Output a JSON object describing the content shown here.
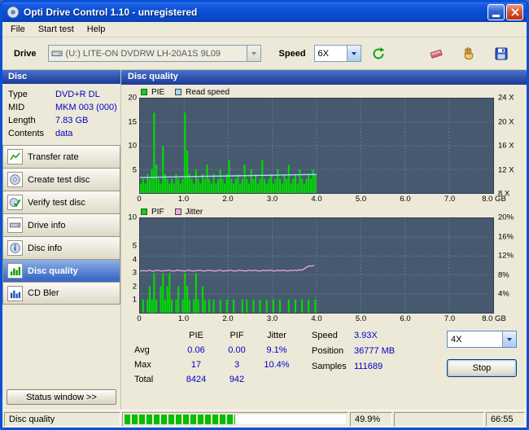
{
  "window": {
    "title": "Opti Drive Control 1.10 - unregistered"
  },
  "menu": {
    "items": [
      "File",
      "Start test",
      "Help"
    ]
  },
  "toolbar": {
    "drive_label": "Drive",
    "drive_value": "(U:) LITE-ON DVDRW LH-20A1S 9L09",
    "speed_label": "Speed",
    "speed_value": "6X"
  },
  "sidebar": {
    "header": "Disc",
    "info": [
      {
        "label": "Type",
        "value": "DVD+R DL"
      },
      {
        "label": "MID",
        "value": "MKM 003 (000)"
      },
      {
        "label": "Length",
        "value": "7.83 GB"
      },
      {
        "label": "Contents",
        "value": "data"
      }
    ],
    "buttons": [
      "Transfer rate",
      "Create test disc",
      "Verify test disc",
      "Drive info",
      "Disc info",
      "Disc quality",
      "CD Bler"
    ],
    "active": "Disc quality",
    "status_window_label": "Status window >>"
  },
  "main": {
    "header": "Disc quality"
  },
  "chart_data": [
    {
      "type": "bar",
      "title": "PIE and read speed vs disc position",
      "legend": [
        "PIE",
        "Read speed"
      ],
      "colors": {
        "pie": "#00DB00",
        "read_speed": "#A6D9F7"
      },
      "x_step_gb": 0.05,
      "x_max_gb": 8,
      "y_left": {
        "label_values": [
          20,
          15,
          10,
          5
        ],
        "max": 20
      },
      "y_right_ticks": [
        "24 X",
        "20 X",
        "16 X",
        "12 X",
        "8 X"
      ],
      "x_ticks": [
        "0",
        "1.0",
        "2.0",
        "3.0",
        "4.0",
        "5.0",
        "6.0",
        "7.0",
        "8.0 GB"
      ],
      "pie_values": [
        2,
        3,
        2,
        4,
        3,
        5,
        17,
        6,
        3,
        2,
        10,
        4,
        3,
        2,
        3,
        2,
        4,
        3,
        2,
        3,
        17,
        9,
        4,
        3,
        2,
        5,
        3,
        2,
        4,
        3,
        6,
        3,
        2,
        4,
        2,
        3,
        5,
        3,
        2,
        4,
        7,
        3,
        2,
        3,
        4,
        2,
        3,
        6,
        3,
        2,
        5,
        3,
        4,
        2,
        3,
        7,
        3,
        2,
        3,
        4,
        2,
        3,
        5,
        3,
        2,
        4,
        3,
        6,
        2,
        3,
        4,
        2,
        5,
        3,
        2,
        3,
        4,
        3,
        5,
        4
      ],
      "read_speed_line": [
        [
          0,
          3.3
        ],
        [
          4.0,
          3.93
        ]
      ]
    },
    {
      "type": "bar+line",
      "title": "PIF and jitter vs disc position",
      "legend": [
        "PIF",
        "Jitter"
      ],
      "colors": {
        "pif": "#00DB00",
        "jitter": "#F0A8E8"
      },
      "x_step_gb": 0.05,
      "x_max_gb": 8,
      "y_left_ticks": [
        {
          "label": "10",
          "f": 1.0
        },
        {
          "label": "5",
          "f": 0.7
        },
        {
          "label": "4",
          "f": 0.56
        },
        {
          "label": "3",
          "f": 0.42
        },
        {
          "label": "2",
          "f": 0.28
        },
        {
          "label": "1",
          "f": 0.14
        }
      ],
      "y_right_ticks": [
        "20%",
        "16%",
        "12%",
        "8%",
        "4%"
      ],
      "x_ticks": [
        "0",
        "1.0",
        "2.0",
        "3.0",
        "4.0",
        "5.0",
        "6.0",
        "7.0",
        "8.0 GB"
      ],
      "pif_values": [
        0,
        1,
        0,
        1,
        2,
        1,
        3,
        1,
        0,
        2,
        3,
        1,
        2,
        3,
        1,
        0,
        1,
        2,
        0,
        1,
        3,
        2,
        1,
        0,
        1,
        3,
        1,
        0,
        2,
        1,
        0,
        1,
        0,
        1,
        0,
        0,
        1,
        0,
        0,
        1,
        0,
        0,
        1,
        0,
        0,
        0,
        1,
        0,
        1,
        0,
        0,
        1,
        0,
        0,
        1,
        0,
        0,
        1,
        0,
        0,
        1,
        0,
        0,
        1,
        0,
        0,
        0,
        1,
        0,
        0,
        1,
        0,
        0,
        1,
        0,
        0,
        1,
        0,
        0,
        1
      ],
      "jitter_percent": [
        8.8,
        8.9,
        8.9,
        8.8,
        9.0,
        8.9,
        8.8,
        8.9,
        9.0,
        8.9,
        8.8,
        8.9,
        8.9,
        9.0,
        8.9,
        8.8,
        8.9,
        9.0,
        8.9,
        8.9,
        8.8,
        8.9,
        9.0,
        8.9,
        8.8,
        8.9,
        8.9,
        9.0,
        8.9,
        8.8,
        8.9,
        9.0,
        8.9,
        8.9,
        8.8,
        8.9,
        9.0,
        8.9,
        8.8,
        8.9,
        8.9,
        9.0,
        8.9,
        8.8,
        8.9,
        9.0,
        8.9,
        8.9,
        8.8,
        9.0,
        8.9,
        8.9,
        9.0,
        8.9,
        8.8,
        8.9,
        9.0,
        8.9,
        8.9,
        9.0,
        8.9,
        8.8,
        9.0,
        8.9,
        8.9,
        9.0,
        8.9,
        8.8,
        9.0,
        8.9,
        9.0,
        8.9,
        9.1,
        9.0,
        9.2,
        9.5,
        9.8,
        9.9,
        9.9,
        10.0
      ]
    }
  ],
  "stats": {
    "columns": [
      "PIE",
      "PIF",
      "Jitter"
    ],
    "rows": [
      {
        "label": "Avg",
        "values": [
          "0.06",
          "0.00",
          "9.1%"
        ]
      },
      {
        "label": "Max",
        "values": [
          "17",
          "3",
          "10.4%"
        ]
      },
      {
        "label": "Total",
        "values": [
          "8424",
          "942",
          ""
        ]
      }
    ],
    "speed": {
      "label": "Speed",
      "value": "3.93X"
    },
    "position": {
      "label": "Position",
      "value": "36777 MB"
    },
    "samples": {
      "label": "Samples",
      "value": "111689"
    },
    "speed_select": "4X",
    "stop_label": "Stop"
  },
  "statusbar": {
    "mode": "Disc quality",
    "percent": "49.9%",
    "time": "66:55"
  }
}
